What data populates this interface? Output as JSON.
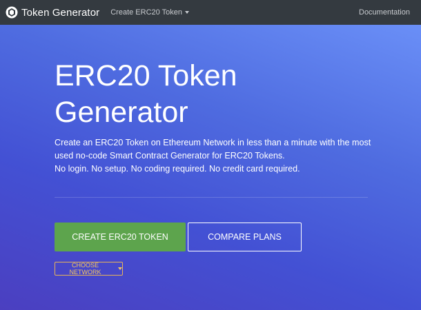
{
  "navbar": {
    "brand": "Token Generator",
    "dropdown_label": "Create ERC20 Token",
    "documentation_label": "Documentation"
  },
  "hero": {
    "title_line1": "ERC20 Token",
    "title_line2": "Generator",
    "description_line1": "Create an ERC20 Token on Ethereum Network in less than a minute with the most",
    "description_line2": "used no-code Smart Contract Generator for ERC20 Tokens.",
    "description_line3": "No login. No setup. No coding required. No credit card required."
  },
  "buttons": {
    "create_label": "CREATE ERC20 TOKEN",
    "compare_label": "COMPARE PLANS",
    "network_label": "CHOOSE NETWORK"
  },
  "colors": {
    "navbar": "#343a40",
    "create_button": "#5da44d",
    "network_accent": "#f6c760"
  }
}
